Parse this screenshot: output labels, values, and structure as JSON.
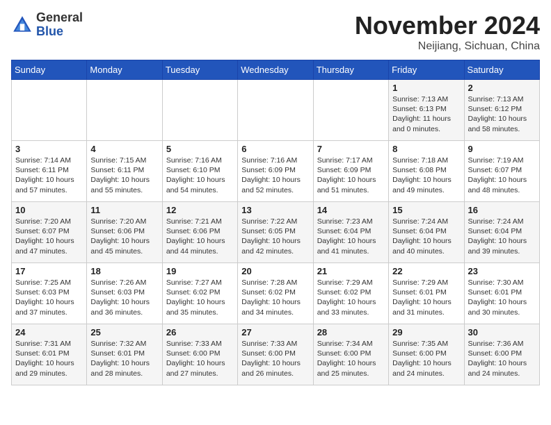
{
  "header": {
    "logo_general": "General",
    "logo_blue": "Blue",
    "month_title": "November 2024",
    "location": "Neijiang, Sichuan, China"
  },
  "weekdays": [
    "Sunday",
    "Monday",
    "Tuesday",
    "Wednesday",
    "Thursday",
    "Friday",
    "Saturday"
  ],
  "weeks": [
    [
      {
        "day": "",
        "info": ""
      },
      {
        "day": "",
        "info": ""
      },
      {
        "day": "",
        "info": ""
      },
      {
        "day": "",
        "info": ""
      },
      {
        "day": "",
        "info": ""
      },
      {
        "day": "1",
        "info": "Sunrise: 7:13 AM\nSunset: 6:13 PM\nDaylight: 11 hours\nand 0 minutes."
      },
      {
        "day": "2",
        "info": "Sunrise: 7:13 AM\nSunset: 6:12 PM\nDaylight: 10 hours\nand 58 minutes."
      }
    ],
    [
      {
        "day": "3",
        "info": "Sunrise: 7:14 AM\nSunset: 6:11 PM\nDaylight: 10 hours\nand 57 minutes."
      },
      {
        "day": "4",
        "info": "Sunrise: 7:15 AM\nSunset: 6:11 PM\nDaylight: 10 hours\nand 55 minutes."
      },
      {
        "day": "5",
        "info": "Sunrise: 7:16 AM\nSunset: 6:10 PM\nDaylight: 10 hours\nand 54 minutes."
      },
      {
        "day": "6",
        "info": "Sunrise: 7:16 AM\nSunset: 6:09 PM\nDaylight: 10 hours\nand 52 minutes."
      },
      {
        "day": "7",
        "info": "Sunrise: 7:17 AM\nSunset: 6:09 PM\nDaylight: 10 hours\nand 51 minutes."
      },
      {
        "day": "8",
        "info": "Sunrise: 7:18 AM\nSunset: 6:08 PM\nDaylight: 10 hours\nand 49 minutes."
      },
      {
        "day": "9",
        "info": "Sunrise: 7:19 AM\nSunset: 6:07 PM\nDaylight: 10 hours\nand 48 minutes."
      }
    ],
    [
      {
        "day": "10",
        "info": "Sunrise: 7:20 AM\nSunset: 6:07 PM\nDaylight: 10 hours\nand 47 minutes."
      },
      {
        "day": "11",
        "info": "Sunrise: 7:20 AM\nSunset: 6:06 PM\nDaylight: 10 hours\nand 45 minutes."
      },
      {
        "day": "12",
        "info": "Sunrise: 7:21 AM\nSunset: 6:06 PM\nDaylight: 10 hours\nand 44 minutes."
      },
      {
        "day": "13",
        "info": "Sunrise: 7:22 AM\nSunset: 6:05 PM\nDaylight: 10 hours\nand 42 minutes."
      },
      {
        "day": "14",
        "info": "Sunrise: 7:23 AM\nSunset: 6:04 PM\nDaylight: 10 hours\nand 41 minutes."
      },
      {
        "day": "15",
        "info": "Sunrise: 7:24 AM\nSunset: 6:04 PM\nDaylight: 10 hours\nand 40 minutes."
      },
      {
        "day": "16",
        "info": "Sunrise: 7:24 AM\nSunset: 6:04 PM\nDaylight: 10 hours\nand 39 minutes."
      }
    ],
    [
      {
        "day": "17",
        "info": "Sunrise: 7:25 AM\nSunset: 6:03 PM\nDaylight: 10 hours\nand 37 minutes."
      },
      {
        "day": "18",
        "info": "Sunrise: 7:26 AM\nSunset: 6:03 PM\nDaylight: 10 hours\nand 36 minutes."
      },
      {
        "day": "19",
        "info": "Sunrise: 7:27 AM\nSunset: 6:02 PM\nDaylight: 10 hours\nand 35 minutes."
      },
      {
        "day": "20",
        "info": "Sunrise: 7:28 AM\nSunset: 6:02 PM\nDaylight: 10 hours\nand 34 minutes."
      },
      {
        "day": "21",
        "info": "Sunrise: 7:29 AM\nSunset: 6:02 PM\nDaylight: 10 hours\nand 33 minutes."
      },
      {
        "day": "22",
        "info": "Sunrise: 7:29 AM\nSunset: 6:01 PM\nDaylight: 10 hours\nand 31 minutes."
      },
      {
        "day": "23",
        "info": "Sunrise: 7:30 AM\nSunset: 6:01 PM\nDaylight: 10 hours\nand 30 minutes."
      }
    ],
    [
      {
        "day": "24",
        "info": "Sunrise: 7:31 AM\nSunset: 6:01 PM\nDaylight: 10 hours\nand 29 minutes."
      },
      {
        "day": "25",
        "info": "Sunrise: 7:32 AM\nSunset: 6:01 PM\nDaylight: 10 hours\nand 28 minutes."
      },
      {
        "day": "26",
        "info": "Sunrise: 7:33 AM\nSunset: 6:00 PM\nDaylight: 10 hours\nand 27 minutes."
      },
      {
        "day": "27",
        "info": "Sunrise: 7:33 AM\nSunset: 6:00 PM\nDaylight: 10 hours\nand 26 minutes."
      },
      {
        "day": "28",
        "info": "Sunrise: 7:34 AM\nSunset: 6:00 PM\nDaylight: 10 hours\nand 25 minutes."
      },
      {
        "day": "29",
        "info": "Sunrise: 7:35 AM\nSunset: 6:00 PM\nDaylight: 10 hours\nand 24 minutes."
      },
      {
        "day": "30",
        "info": "Sunrise: 7:36 AM\nSunset: 6:00 PM\nDaylight: 10 hours\nand 24 minutes."
      }
    ]
  ]
}
